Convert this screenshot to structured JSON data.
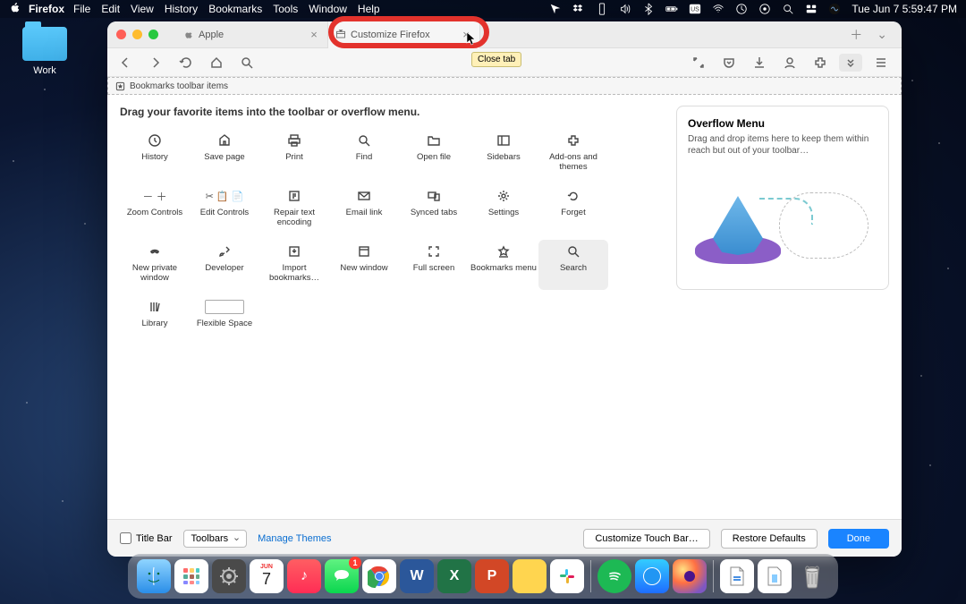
{
  "menubar": {
    "app": "Firefox",
    "items": [
      "File",
      "Edit",
      "View",
      "History",
      "Bookmarks",
      "Tools",
      "Window",
      "Help"
    ],
    "clock": "Tue Jun 7  5:59:47 PM"
  },
  "desktop": {
    "folder_label": "Work"
  },
  "tabs": {
    "t0": {
      "label": "Apple"
    },
    "t1": {
      "label": "Customize Firefox"
    },
    "tooltip": "Close tab"
  },
  "bookmark_strip": "Bookmarks toolbar items",
  "customize": {
    "hint": "Drag your favorite items into the toolbar or overflow menu.",
    "items": [
      {
        "id": "history",
        "label": "History"
      },
      {
        "id": "save-page",
        "label": "Save page"
      },
      {
        "id": "print",
        "label": "Print"
      },
      {
        "id": "find",
        "label": "Find"
      },
      {
        "id": "open-file",
        "label": "Open file"
      },
      {
        "id": "sidebars",
        "label": "Sidebars"
      },
      {
        "id": "addons",
        "label": "Add-ons and themes"
      },
      {
        "id": "zoom",
        "label": "Zoom Controls"
      },
      {
        "id": "edit-controls",
        "label": "Edit Controls"
      },
      {
        "id": "repair-text",
        "label": "Repair text encoding"
      },
      {
        "id": "email-link",
        "label": "Email link"
      },
      {
        "id": "synced-tabs",
        "label": "Synced tabs"
      },
      {
        "id": "settings",
        "label": "Settings"
      },
      {
        "id": "forget",
        "label": "Forget"
      },
      {
        "id": "new-private",
        "label": "New private window"
      },
      {
        "id": "developer",
        "label": "Developer"
      },
      {
        "id": "import-bm",
        "label": "Import bookmarks…"
      },
      {
        "id": "new-window",
        "label": "New window"
      },
      {
        "id": "full-screen",
        "label": "Full screen"
      },
      {
        "id": "bookmarks-menu",
        "label": "Bookmarks menu"
      },
      {
        "id": "search",
        "label": "Search"
      },
      {
        "id": "library",
        "label": "Library"
      },
      {
        "id": "flex-space",
        "label": "Flexible Space"
      }
    ]
  },
  "overflow": {
    "title": "Overflow Menu",
    "desc": "Drag and drop items here to keep them within reach but out of your toolbar…"
  },
  "footer": {
    "titlebar": "Title Bar",
    "toolbars": "Toolbars",
    "manage": "Manage Themes",
    "touchbar": "Customize Touch Bar…",
    "restore": "Restore Defaults",
    "done": "Done"
  },
  "dock_badge": "1"
}
